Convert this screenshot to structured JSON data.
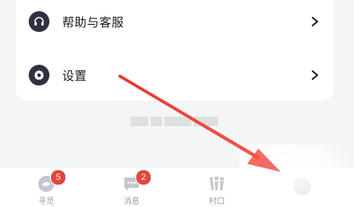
{
  "menu": {
    "items": [
      {
        "label": "帮助与客服",
        "icon": "headset-icon"
      },
      {
        "label": "设置",
        "icon": "gear-icon"
      }
    ]
  },
  "tabbar": {
    "tabs": [
      {
        "label": "寻觅",
        "badge": "5",
        "icon": "discover-icon"
      },
      {
        "label": "消息",
        "badge": "2",
        "icon": "message-icon"
      },
      {
        "label": "村口",
        "icon": "village-icon"
      },
      {
        "icon": "profile-icon"
      }
    ]
  },
  "annotation": {
    "arrow_color": "#e8332a"
  },
  "colors": {
    "badge": "#e5453c",
    "icon_dark": "#2d3241",
    "background": "#f4f5f7"
  }
}
